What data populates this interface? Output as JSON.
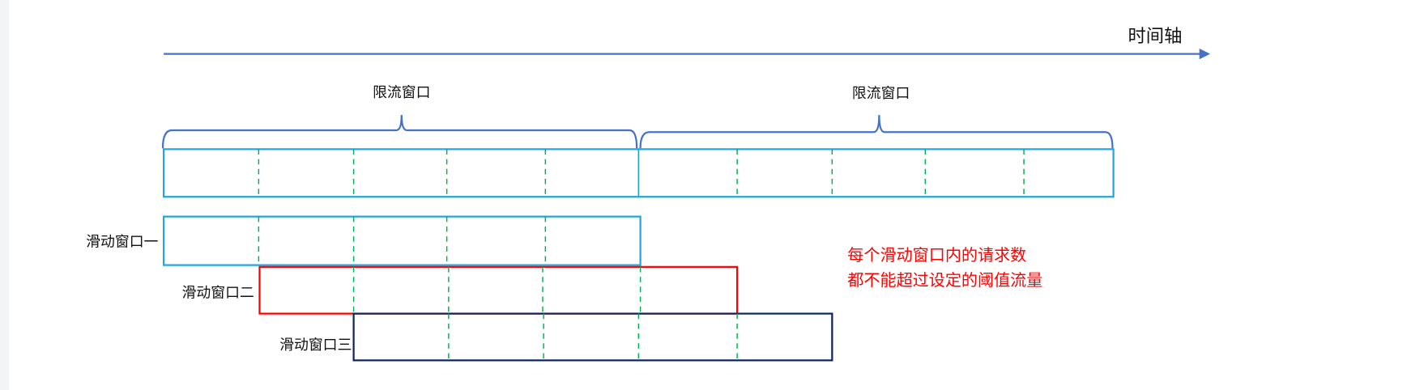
{
  "axis_label": "时间轴",
  "rate_limit_windows": [
    {
      "label": "限流窗口"
    },
    {
      "label": "限流窗口"
    }
  ],
  "sliding_windows": [
    {
      "label": "滑动窗口一",
      "color": "#1fa6e0"
    },
    {
      "label": "滑动窗口二",
      "color": "#ff0000"
    },
    {
      "label": "滑动窗口三",
      "color": "#0d2560"
    }
  ],
  "note": {
    "line1": "每个滑动窗口内的请求数",
    "line2": "都不能超过设定的阈值流量",
    "color": "#ff0000"
  },
  "colors": {
    "axis": "#4472c4",
    "grid": "#1fa6e0",
    "dash": "#00b050"
  }
}
